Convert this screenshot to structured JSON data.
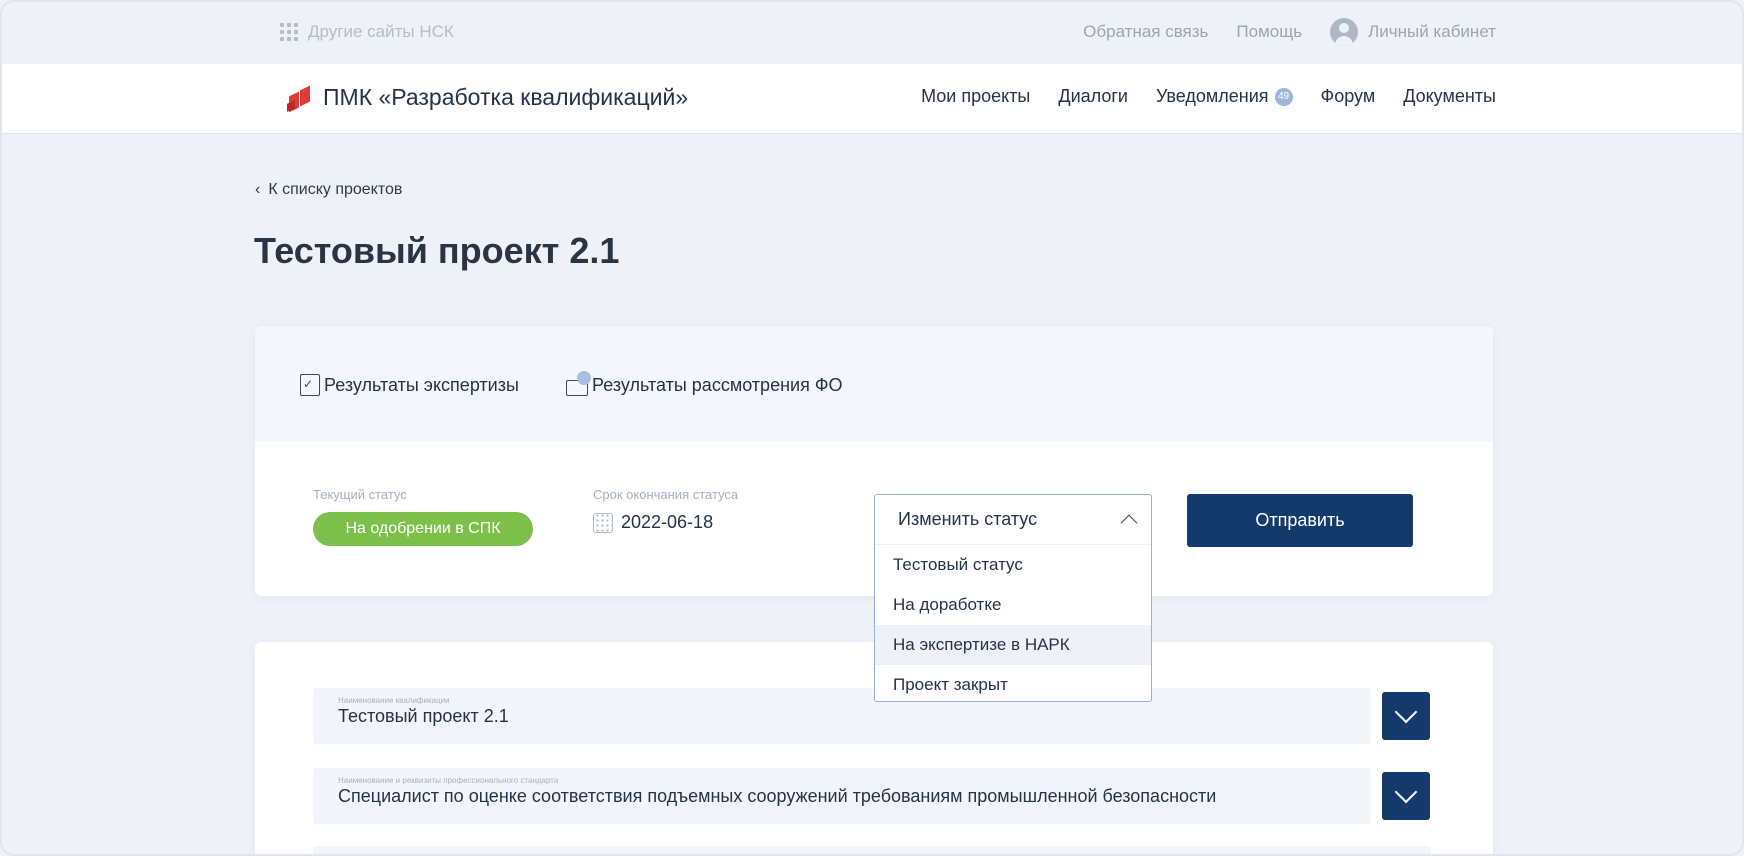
{
  "topbar": {
    "other_sites": "Другие сайты НСК",
    "feedback": "Обратная связь",
    "help": "Помощь",
    "account": "Личный кабинет"
  },
  "header": {
    "brand": "ПМК «Разработка квалификаций»",
    "nav": {
      "projects": "Мои проекты",
      "dialogs": "Диалоги",
      "notifications": "Уведомления",
      "notifications_count": "49",
      "forum": "Форум",
      "documents": "Документы"
    }
  },
  "back_link": "К списку проектов",
  "page_title": "Тестовый проект 2.1",
  "tabs": {
    "expertise": "Результаты экспертизы",
    "fo": "Результаты рассмотрения ФО"
  },
  "status": {
    "current_label": "Текущий статус",
    "current_value": "На одобрении в СПК",
    "deadline_label": "Срок окончания статуса",
    "deadline_value": "2022-06-18",
    "send_button": "Отправить"
  },
  "dropdown": {
    "placeholder": "Изменить статус",
    "options": [
      "Тестовый статус",
      "На доработке",
      "На экспертизе в НАРК",
      "Проект закрыт"
    ]
  },
  "fields": [
    {
      "label": "Наименование квалификации",
      "value": "Тестовый проект 2.1"
    },
    {
      "label": "Наименование и реквизиты профессионального стандарта",
      "value": "Специалист по оценке соответствия подъемных сооружений требованиям промышленной безопасности"
    }
  ],
  "colors": {
    "primary": "#143a6b",
    "status_green": "#7cc04b",
    "brand_red": "#e23a34"
  }
}
